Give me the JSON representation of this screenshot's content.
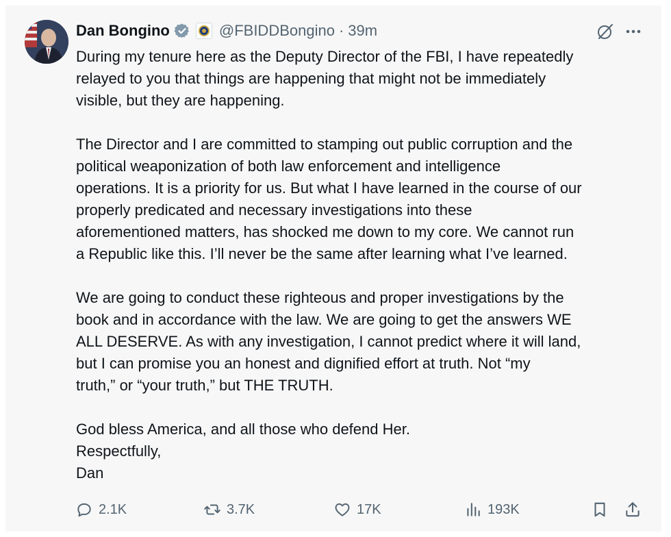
{
  "tweet": {
    "author_name": "Dan Bongino",
    "handle": "@FBIDDBongino",
    "separator": "·",
    "time": "39m",
    "paragraphs": [
      [
        "During my tenure here as the Deputy Director of the FBI, I have repeatedly",
        "relayed to you that things are happening that might not be immediately",
        "visible, but they are happening."
      ],
      [
        "The Director and I are committed to stamping out public corruption and the",
        "political weaponization of both law enforcement and intelligence",
        "operations. It is a priority for us. But what I have learned in the course of our",
        "properly predicated and necessary investigations into these",
        "aforementioned matters, has shocked me down to my core. We cannot run",
        "a Republic like this. I’ll never be the same after learning what I’ve learned."
      ],
      [
        "We are going to conduct these righteous and proper investigations by the",
        "book and in accordance with the law. We are going to get the answers WE",
        "ALL DESERVE. As with any investigation, I cannot predict where it will land,",
        "but I can promise you an honest and dignified effort at truth. Not “my",
        "truth,” or “your truth,” but THE TRUTH."
      ],
      [
        "God bless America, and all those who defend Her.",
        "Respectfully,",
        "Dan"
      ]
    ]
  },
  "actions": {
    "replies": "2.1K",
    "reposts": "3.7K",
    "likes": "17K",
    "views": "193K"
  },
  "icons": {
    "verified": "verified-badge-icon",
    "affiliation": "fbi-seal-icon",
    "grok": "grok-icon",
    "more": "more-icon",
    "reply": "reply-icon",
    "repost": "repost-icon",
    "like": "heart-icon",
    "views": "views-chart-icon",
    "bookmark": "bookmark-icon",
    "share": "share-icon"
  },
  "colors": {
    "verified": "#829aab",
    "secondary_text": "#536471",
    "card_background": "#f7f7f7"
  }
}
